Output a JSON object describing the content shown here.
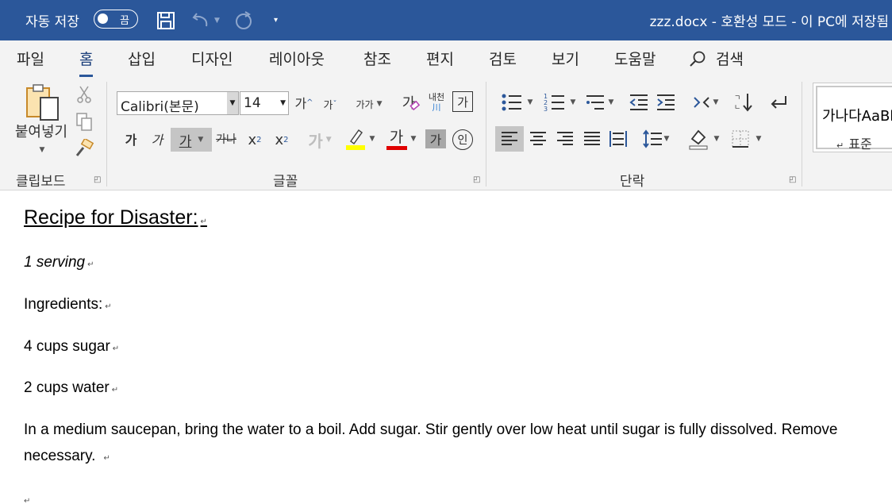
{
  "titlebar": {
    "autosave_label": "자동 저장",
    "autosave_state": "끔",
    "title": "zzz.docx  -  호환성 모드  -  이 PC에 저장됨"
  },
  "tabs": [
    "파일",
    "홈",
    "삽입",
    "디자인",
    "레이아웃",
    "참조",
    "편지",
    "검토",
    "보기",
    "도움말"
  ],
  "active_tab": "홈",
  "search_label": "검색",
  "clipboard": {
    "paste_label": "붙여넣기",
    "group_label": "클립보드"
  },
  "font": {
    "family": "Calibri(본문)",
    "size": "14",
    "grow": "가",
    "shrink": "가",
    "change_case": "가가",
    "bold": "가",
    "italic": "가",
    "underline": "가",
    "strike": "가나",
    "subscript_base": "x",
    "subscript": "2",
    "superscript_base": "x",
    "superscript": "2",
    "text_effect": "가",
    "font_color": "가",
    "char_shading": "가",
    "enclosed": "인",
    "phonetic": "내천",
    "phonetic_sub": "川",
    "char_border": "가",
    "clear": "가",
    "group_label": "글꼴",
    "highlight_color": "#ffff00",
    "font_color_value": "#e00000"
  },
  "paragraph": {
    "group_label": "단락"
  },
  "styles": {
    "sample": "가나다AaBb",
    "name": "표준"
  },
  "document": {
    "heading": "Recipe for Disaster:",
    "servings": "1 serving",
    "ingredients_label": "Ingredients:",
    "ingredient_1": "4 cups sugar",
    "ingredient_2": "2 cups water",
    "instructions_line1": "In a medium saucepan, bring the water to a boil. Add sugar. Stir gently over low heat until sugar is fully dissolved. Remove",
    "instructions_line2": "necessary.",
    "paragraph_mark": "↵"
  }
}
